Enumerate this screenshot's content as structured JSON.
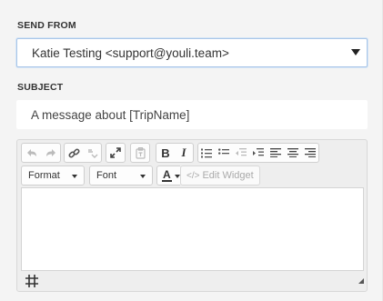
{
  "send_from": {
    "label": "SEND FROM",
    "selected": "Katie Testing <support@youli.team>"
  },
  "subject": {
    "label": "SUBJECT",
    "value": "A message about [TripName]"
  },
  "editor": {
    "format_dropdown": "Format",
    "font_dropdown": "Font",
    "font_color_letter": "A",
    "edit_widget_label": "Edit Widget",
    "edit_widget_icon_glyph": "</>",
    "toolbar_icons": [
      "undo-icon",
      "redo-icon",
      "link-icon",
      "unlink-icon",
      "maximize-icon",
      "paste-text-icon",
      "bold-icon",
      "italic-icon",
      "numbered-list-icon",
      "bulleted-list-icon",
      "outdent-icon",
      "indent-icon",
      "align-left-icon",
      "align-center-icon",
      "align-right-icon",
      "font-color-icon",
      "code-icon",
      "grid-icon",
      "resize-grip-icon"
    ],
    "colors": {
      "accent_border": "#a9c6e8",
      "disabled_icon": "#bbbbbb",
      "font_color_underline": "#333333"
    }
  }
}
